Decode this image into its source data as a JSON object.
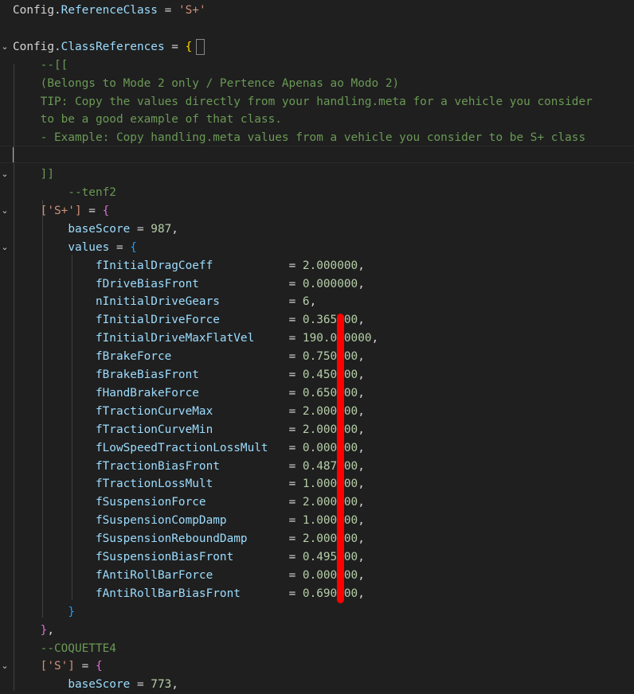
{
  "code": {
    "lines": [
      {
        "fold": "",
        "parts": [
          {
            "t": "Config",
            "c": "w"
          },
          {
            "t": ".",
            "c": "w"
          },
          {
            "t": "ReferenceClass",
            "c": "p"
          },
          {
            "t": " = ",
            "c": "w"
          },
          {
            "t": "'S+'",
            "c": "s"
          }
        ]
      },
      {
        "fold": "",
        "parts": []
      },
      {
        "fold": "⌄",
        "parts": [
          {
            "t": "Config",
            "c": "w"
          },
          {
            "t": ".",
            "c": "w"
          },
          {
            "t": "ClassReferences",
            "c": "p"
          },
          {
            "t": " = ",
            "c": "w"
          },
          {
            "t": "{",
            "c": "b1"
          }
        ]
      },
      {
        "fold": "",
        "parts": [
          {
            "t": "    --[[",
            "c": "c"
          }
        ]
      },
      {
        "fold": "",
        "parts": [
          {
            "t": "    (Belongs to Mode 2 only / Pertence Apenas ao Modo 2)",
            "c": "c"
          }
        ]
      },
      {
        "fold": "",
        "parts": [
          {
            "t": "    TIP: Copy the values directly from your handling.meta for a vehicle you consider",
            "c": "c"
          }
        ]
      },
      {
        "fold": "",
        "parts": [
          {
            "t": "    to be a good example of that class.",
            "c": "c"
          }
        ]
      },
      {
        "fold": "",
        "parts": [
          {
            "t": "    - Example: Copy handling.meta values from a vehicle you consider to be S+ class",
            "c": "c"
          }
        ]
      },
      {
        "fold": "",
        "parts": []
      },
      {
        "fold": "⌄",
        "parts": [
          {
            "t": "    ]]",
            "c": "c"
          }
        ]
      },
      {
        "fold": "",
        "parts": [
          {
            "t": "        --tenf2",
            "c": "c"
          }
        ]
      },
      {
        "fold": "⌄",
        "parts": [
          {
            "t": "    ",
            "c": "w"
          },
          {
            "t": "['S+']",
            "c": "s"
          },
          {
            "t": " = ",
            "c": "w"
          },
          {
            "t": "{",
            "c": "b2"
          }
        ]
      },
      {
        "fold": "",
        "parts": [
          {
            "t": "        ",
            "c": "w"
          },
          {
            "t": "baseScore",
            "c": "p"
          },
          {
            "t": " = ",
            "c": "w"
          },
          {
            "t": "987",
            "c": "n"
          },
          {
            "t": ",",
            "c": "w"
          }
        ]
      },
      {
        "fold": "⌄",
        "parts": [
          {
            "t": "        ",
            "c": "w"
          },
          {
            "t": "values",
            "c": "p"
          },
          {
            "t": " = ",
            "c": "w"
          },
          {
            "t": "{",
            "c": "b3"
          }
        ]
      },
      {
        "fold": "",
        "parts": [
          {
            "t": "            ",
            "c": "w"
          },
          {
            "t": "fInitialDragCoeff          ",
            "c": "p"
          },
          {
            "t": " = ",
            "c": "w"
          },
          {
            "t": "2.000000",
            "c": "n"
          },
          {
            "t": ",",
            "c": "w"
          }
        ]
      },
      {
        "fold": "",
        "parts": [
          {
            "t": "            ",
            "c": "w"
          },
          {
            "t": "fDriveBiasFront            ",
            "c": "p"
          },
          {
            "t": " = ",
            "c": "w"
          },
          {
            "t": "0.000000",
            "c": "n"
          },
          {
            "t": ",",
            "c": "w"
          }
        ]
      },
      {
        "fold": "",
        "parts": [
          {
            "t": "            ",
            "c": "w"
          },
          {
            "t": "nInitialDriveGears         ",
            "c": "p"
          },
          {
            "t": " = ",
            "c": "w"
          },
          {
            "t": "6",
            "c": "n"
          },
          {
            "t": ",",
            "c": "w"
          }
        ]
      },
      {
        "fold": "",
        "parts": [
          {
            "t": "            ",
            "c": "w"
          },
          {
            "t": "fInitialDriveForce         ",
            "c": "p"
          },
          {
            "t": " = ",
            "c": "w"
          },
          {
            "t": "0.365000",
            "c": "n"
          },
          {
            "t": ",",
            "c": "w"
          }
        ]
      },
      {
        "fold": "",
        "parts": [
          {
            "t": "            ",
            "c": "w"
          },
          {
            "t": "fInitialDriveMaxFlatVel    ",
            "c": "p"
          },
          {
            "t": " = ",
            "c": "w"
          },
          {
            "t": "190.000000",
            "c": "n"
          },
          {
            "t": ",",
            "c": "w"
          }
        ]
      },
      {
        "fold": "",
        "parts": [
          {
            "t": "            ",
            "c": "w"
          },
          {
            "t": "fBrakeForce                ",
            "c": "p"
          },
          {
            "t": " = ",
            "c": "w"
          },
          {
            "t": "0.750000",
            "c": "n"
          },
          {
            "t": ",",
            "c": "w"
          }
        ]
      },
      {
        "fold": "",
        "parts": [
          {
            "t": "            ",
            "c": "w"
          },
          {
            "t": "fBrakeBiasFront            ",
            "c": "p"
          },
          {
            "t": " = ",
            "c": "w"
          },
          {
            "t": "0.450000",
            "c": "n"
          },
          {
            "t": ",",
            "c": "w"
          }
        ]
      },
      {
        "fold": "",
        "parts": [
          {
            "t": "            ",
            "c": "w"
          },
          {
            "t": "fHandBrakeForce            ",
            "c": "p"
          },
          {
            "t": " = ",
            "c": "w"
          },
          {
            "t": "0.650000",
            "c": "n"
          },
          {
            "t": ",",
            "c": "w"
          }
        ]
      },
      {
        "fold": "",
        "parts": [
          {
            "t": "            ",
            "c": "w"
          },
          {
            "t": "fTractionCurveMax          ",
            "c": "p"
          },
          {
            "t": " = ",
            "c": "w"
          },
          {
            "t": "2.000000",
            "c": "n"
          },
          {
            "t": ",",
            "c": "w"
          }
        ]
      },
      {
        "fold": "",
        "parts": [
          {
            "t": "            ",
            "c": "w"
          },
          {
            "t": "fTractionCurveMin          ",
            "c": "p"
          },
          {
            "t": " = ",
            "c": "w"
          },
          {
            "t": "2.000000",
            "c": "n"
          },
          {
            "t": ",",
            "c": "w"
          }
        ]
      },
      {
        "fold": "",
        "parts": [
          {
            "t": "            ",
            "c": "w"
          },
          {
            "t": "fLowSpeedTractionLossMult  ",
            "c": "p"
          },
          {
            "t": " = ",
            "c": "w"
          },
          {
            "t": "0.000000",
            "c": "n"
          },
          {
            "t": ",",
            "c": "w"
          }
        ]
      },
      {
        "fold": "",
        "parts": [
          {
            "t": "            ",
            "c": "w"
          },
          {
            "t": "fTractionBiasFront         ",
            "c": "p"
          },
          {
            "t": " = ",
            "c": "w"
          },
          {
            "t": "0.487000",
            "c": "n"
          },
          {
            "t": ",",
            "c": "w"
          }
        ]
      },
      {
        "fold": "",
        "parts": [
          {
            "t": "            ",
            "c": "w"
          },
          {
            "t": "fTractionLossMult          ",
            "c": "p"
          },
          {
            "t": " = ",
            "c": "w"
          },
          {
            "t": "1.000000",
            "c": "n"
          },
          {
            "t": ",",
            "c": "w"
          }
        ]
      },
      {
        "fold": "",
        "parts": [
          {
            "t": "            ",
            "c": "w"
          },
          {
            "t": "fSuspensionForce           ",
            "c": "p"
          },
          {
            "t": " = ",
            "c": "w"
          },
          {
            "t": "2.000000",
            "c": "n"
          },
          {
            "t": ",",
            "c": "w"
          }
        ]
      },
      {
        "fold": "",
        "parts": [
          {
            "t": "            ",
            "c": "w"
          },
          {
            "t": "fSuspensionCompDamp        ",
            "c": "p"
          },
          {
            "t": " = ",
            "c": "w"
          },
          {
            "t": "1.000000",
            "c": "n"
          },
          {
            "t": ",",
            "c": "w"
          }
        ]
      },
      {
        "fold": "",
        "parts": [
          {
            "t": "            ",
            "c": "w"
          },
          {
            "t": "fSuspensionReboundDamp     ",
            "c": "p"
          },
          {
            "t": " = ",
            "c": "w"
          },
          {
            "t": "2.000000",
            "c": "n"
          },
          {
            "t": ",",
            "c": "w"
          }
        ]
      },
      {
        "fold": "",
        "parts": [
          {
            "t": "            ",
            "c": "w"
          },
          {
            "t": "fSuspensionBiasFront       ",
            "c": "p"
          },
          {
            "t": " = ",
            "c": "w"
          },
          {
            "t": "0.495000",
            "c": "n"
          },
          {
            "t": ",",
            "c": "w"
          }
        ]
      },
      {
        "fold": "",
        "parts": [
          {
            "t": "            ",
            "c": "w"
          },
          {
            "t": "fAntiRollBarForce          ",
            "c": "p"
          },
          {
            "t": " = ",
            "c": "w"
          },
          {
            "t": "0.000000",
            "c": "n"
          },
          {
            "t": ",",
            "c": "w"
          }
        ]
      },
      {
        "fold": "",
        "parts": [
          {
            "t": "            ",
            "c": "w"
          },
          {
            "t": "fAntiRollBarBiasFront      ",
            "c": "p"
          },
          {
            "t": " = ",
            "c": "w"
          },
          {
            "t": "0.690000",
            "c": "n"
          },
          {
            "t": ",",
            "c": "w"
          }
        ]
      },
      {
        "fold": "",
        "parts": [
          {
            "t": "        ",
            "c": "w"
          },
          {
            "t": "}",
            "c": "b3"
          }
        ]
      },
      {
        "fold": "",
        "parts": [
          {
            "t": "    ",
            "c": "w"
          },
          {
            "t": "}",
            "c": "b2"
          },
          {
            "t": ",",
            "c": "w"
          }
        ]
      },
      {
        "fold": "",
        "parts": [
          {
            "t": "    --COQUETTE4",
            "c": "c"
          }
        ]
      },
      {
        "fold": "⌄",
        "parts": [
          {
            "t": "    ",
            "c": "w"
          },
          {
            "t": "['S']",
            "c": "s"
          },
          {
            "t": " = ",
            "c": "w"
          },
          {
            "t": "{",
            "c": "b2"
          }
        ]
      },
      {
        "fold": "",
        "parts": [
          {
            "t": "        ",
            "c": "w"
          },
          {
            "t": "baseScore",
            "c": "p"
          },
          {
            "t": " = ",
            "c": "w"
          },
          {
            "t": "773",
            "c": "n"
          },
          {
            "t": ",",
            "c": "w"
          }
        ]
      }
    ]
  },
  "colors": {
    "background": "#1f1f1f",
    "property": "#9cdcfe",
    "string": "#ce9178",
    "number": "#b5cea8",
    "comment": "#6a9955",
    "annotation_stroke": "#ff0000"
  },
  "annotation": {
    "kind": "red-marker-stroke",
    "note": ""
  }
}
